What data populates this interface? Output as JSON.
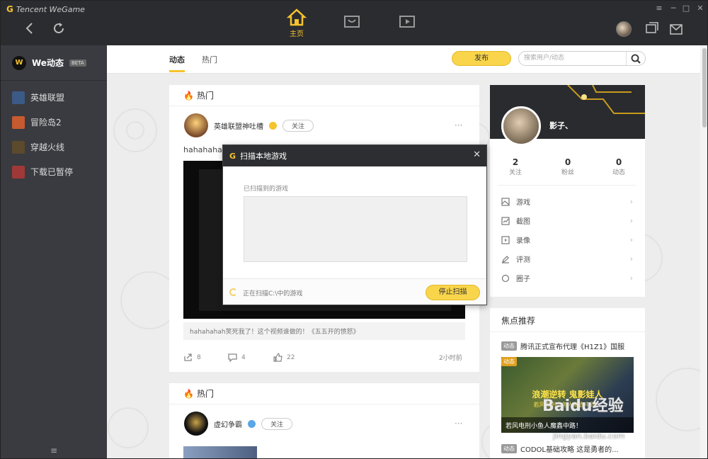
{
  "app": {
    "brand_prefix": "G",
    "brand": "Tencent WeGame"
  },
  "topbar": {
    "home_tab": "主页",
    "window_controls": {
      "menu": "≡",
      "minimize": "─",
      "maximize": "□",
      "close": "✕"
    }
  },
  "sidebar": {
    "title": "We动态",
    "badge": "BETA",
    "items": [
      {
        "label": "英雄联盟",
        "color": "#3b5a86"
      },
      {
        "label": "冒险岛2",
        "color": "#c75a2f"
      },
      {
        "label": "穿越火线",
        "color": "#5b4a2c"
      },
      {
        "label": "下载已暂停",
        "color": "#a13838"
      }
    ],
    "footer_icon": "≡"
  },
  "subheader": {
    "tabs": [
      "动态",
      "热门"
    ],
    "publish": "发布",
    "search_placeholder": "搜索用户/动态"
  },
  "feed": [
    {
      "section": "热门",
      "author": "英雄联盟神吐槽",
      "follow": "关注",
      "text": "hahahahah",
      "caption": "hahahahah笑死我了！这个视频谁做的！《五五开的愤怒》",
      "shares": "8",
      "comments": "4",
      "likes": "22",
      "time": "2小时前"
    },
    {
      "section": "热门",
      "author": "虚幻争霸",
      "follow": "关注"
    }
  ],
  "profile": {
    "name": "影子、",
    "stats": [
      {
        "value": "2",
        "label": "关注"
      },
      {
        "value": "0",
        "label": "粉丝"
      },
      {
        "value": "0",
        "label": "动态"
      }
    ],
    "links": [
      "游戏",
      "截图",
      "录像",
      "评测",
      "圈子"
    ]
  },
  "focus": {
    "title": "焦点推荐",
    "items": [
      {
        "tag": "动态",
        "text": "腾讯正式宣布代理《H1Z1》国服"
      },
      {
        "tag": "动态",
        "banner_title": "浪潮逆转 鬼影娃人",
        "banner_sub": "若风电刑小鱼人魔鑫中路！",
        "caption": "若风电刑小鱼人魔鑫中路！"
      },
      {
        "tag": "动态",
        "text": "CODOL基础攻略 这是勇者的..."
      }
    ]
  },
  "watermark": {
    "text": "Baidu经验",
    "sub": "jingyan.baidu.com"
  },
  "modal": {
    "title": "扫描本地游戏",
    "close": "✕",
    "found_label": "已扫描到的游戏",
    "status": "正在扫描C:\\中的游戏",
    "stop": "停止扫描"
  }
}
